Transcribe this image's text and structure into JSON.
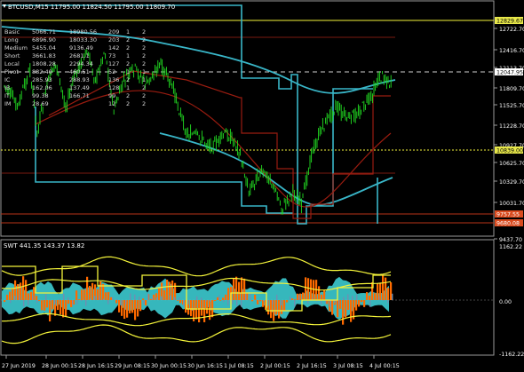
{
  "symbol_header": "BTCUSD,M15  11795.00 11824.50 11795.00 11809.70",
  "stats": {
    "rows": [
      [
        "Basic",
        "5066.71",
        "18980.56",
        "209",
        "1",
        "2"
      ],
      [
        "Long",
        "6896.90",
        "18033.30",
        "203",
        "2",
        "2"
      ],
      [
        "Medium",
        "5455.04",
        "9136.49",
        "142",
        "2",
        "2"
      ],
      [
        "Short",
        "3661.83",
        "2681.1",
        "73",
        "1",
        "2"
      ],
      [
        "Local",
        "1808.28",
        "2294.34",
        "127",
        "2",
        "2"
      ],
      [
        "Pivot",
        "882.40",
        "460.51",
        "52",
        "1",
        "1"
      ],
      [
        "IC",
        "285.93",
        "288.93",
        "136",
        "2",
        "1"
      ],
      [
        "IB",
        "162.06",
        "137.49",
        "128",
        "1",
        "2"
      ],
      [
        "IT",
        "99.38",
        "166.71",
        "99",
        "2",
        "2"
      ],
      [
        "IM",
        "28.69",
        "",
        "12",
        "2",
        "2"
      ]
    ]
  },
  "price_axis": {
    "labels": [
      "12722.70",
      "12416.70",
      "12113.70",
      "11809.70",
      "11525.70",
      "11228.70",
      "10927.70",
      "10625.70",
      "10329.70",
      "10031.70",
      "9437.70"
    ],
    "badges": [
      {
        "text": "12829.67",
        "bg": "#e8e84a",
        "fg": "#000000"
      },
      {
        "text": "12047.95",
        "bg": "#ffffff",
        "fg": "#000000"
      },
      {
        "text": "10839.00",
        "bg": "#e8e84a",
        "fg": "#000000"
      },
      {
        "text": "9757.55",
        "bg": "#d94a1e",
        "fg": "#ffffff"
      },
      {
        "text": "9680.08",
        "bg": "#d94a1e",
        "fg": "#ffffff"
      }
    ]
  },
  "indicator": {
    "label": "SWT 441.35 143.37 13.82",
    "axis": [
      "1162.22",
      "0.00",
      "-1162.22"
    ]
  },
  "time_axis": [
    "27 Jun 2019",
    "28 Jun 00:15",
    "28 Jun 16:15",
    "29 Jun 08:15",
    "30 Jun 00:15",
    "30 Jun 16:15",
    "1 Jul 08:15",
    "2 Jul 00:15",
    "2 Jul 16:15",
    "3 Jul 08:15",
    "4 Jul 00:15"
  ],
  "colors": {
    "candles": "#22dd22",
    "cyan": "#39b6c8",
    "darkred": "#9a1c10",
    "yellow": "#f4f43a",
    "orange": "#ff6a00",
    "teal_fill": "#3ccbd0",
    "grid": "#555555"
  }
}
